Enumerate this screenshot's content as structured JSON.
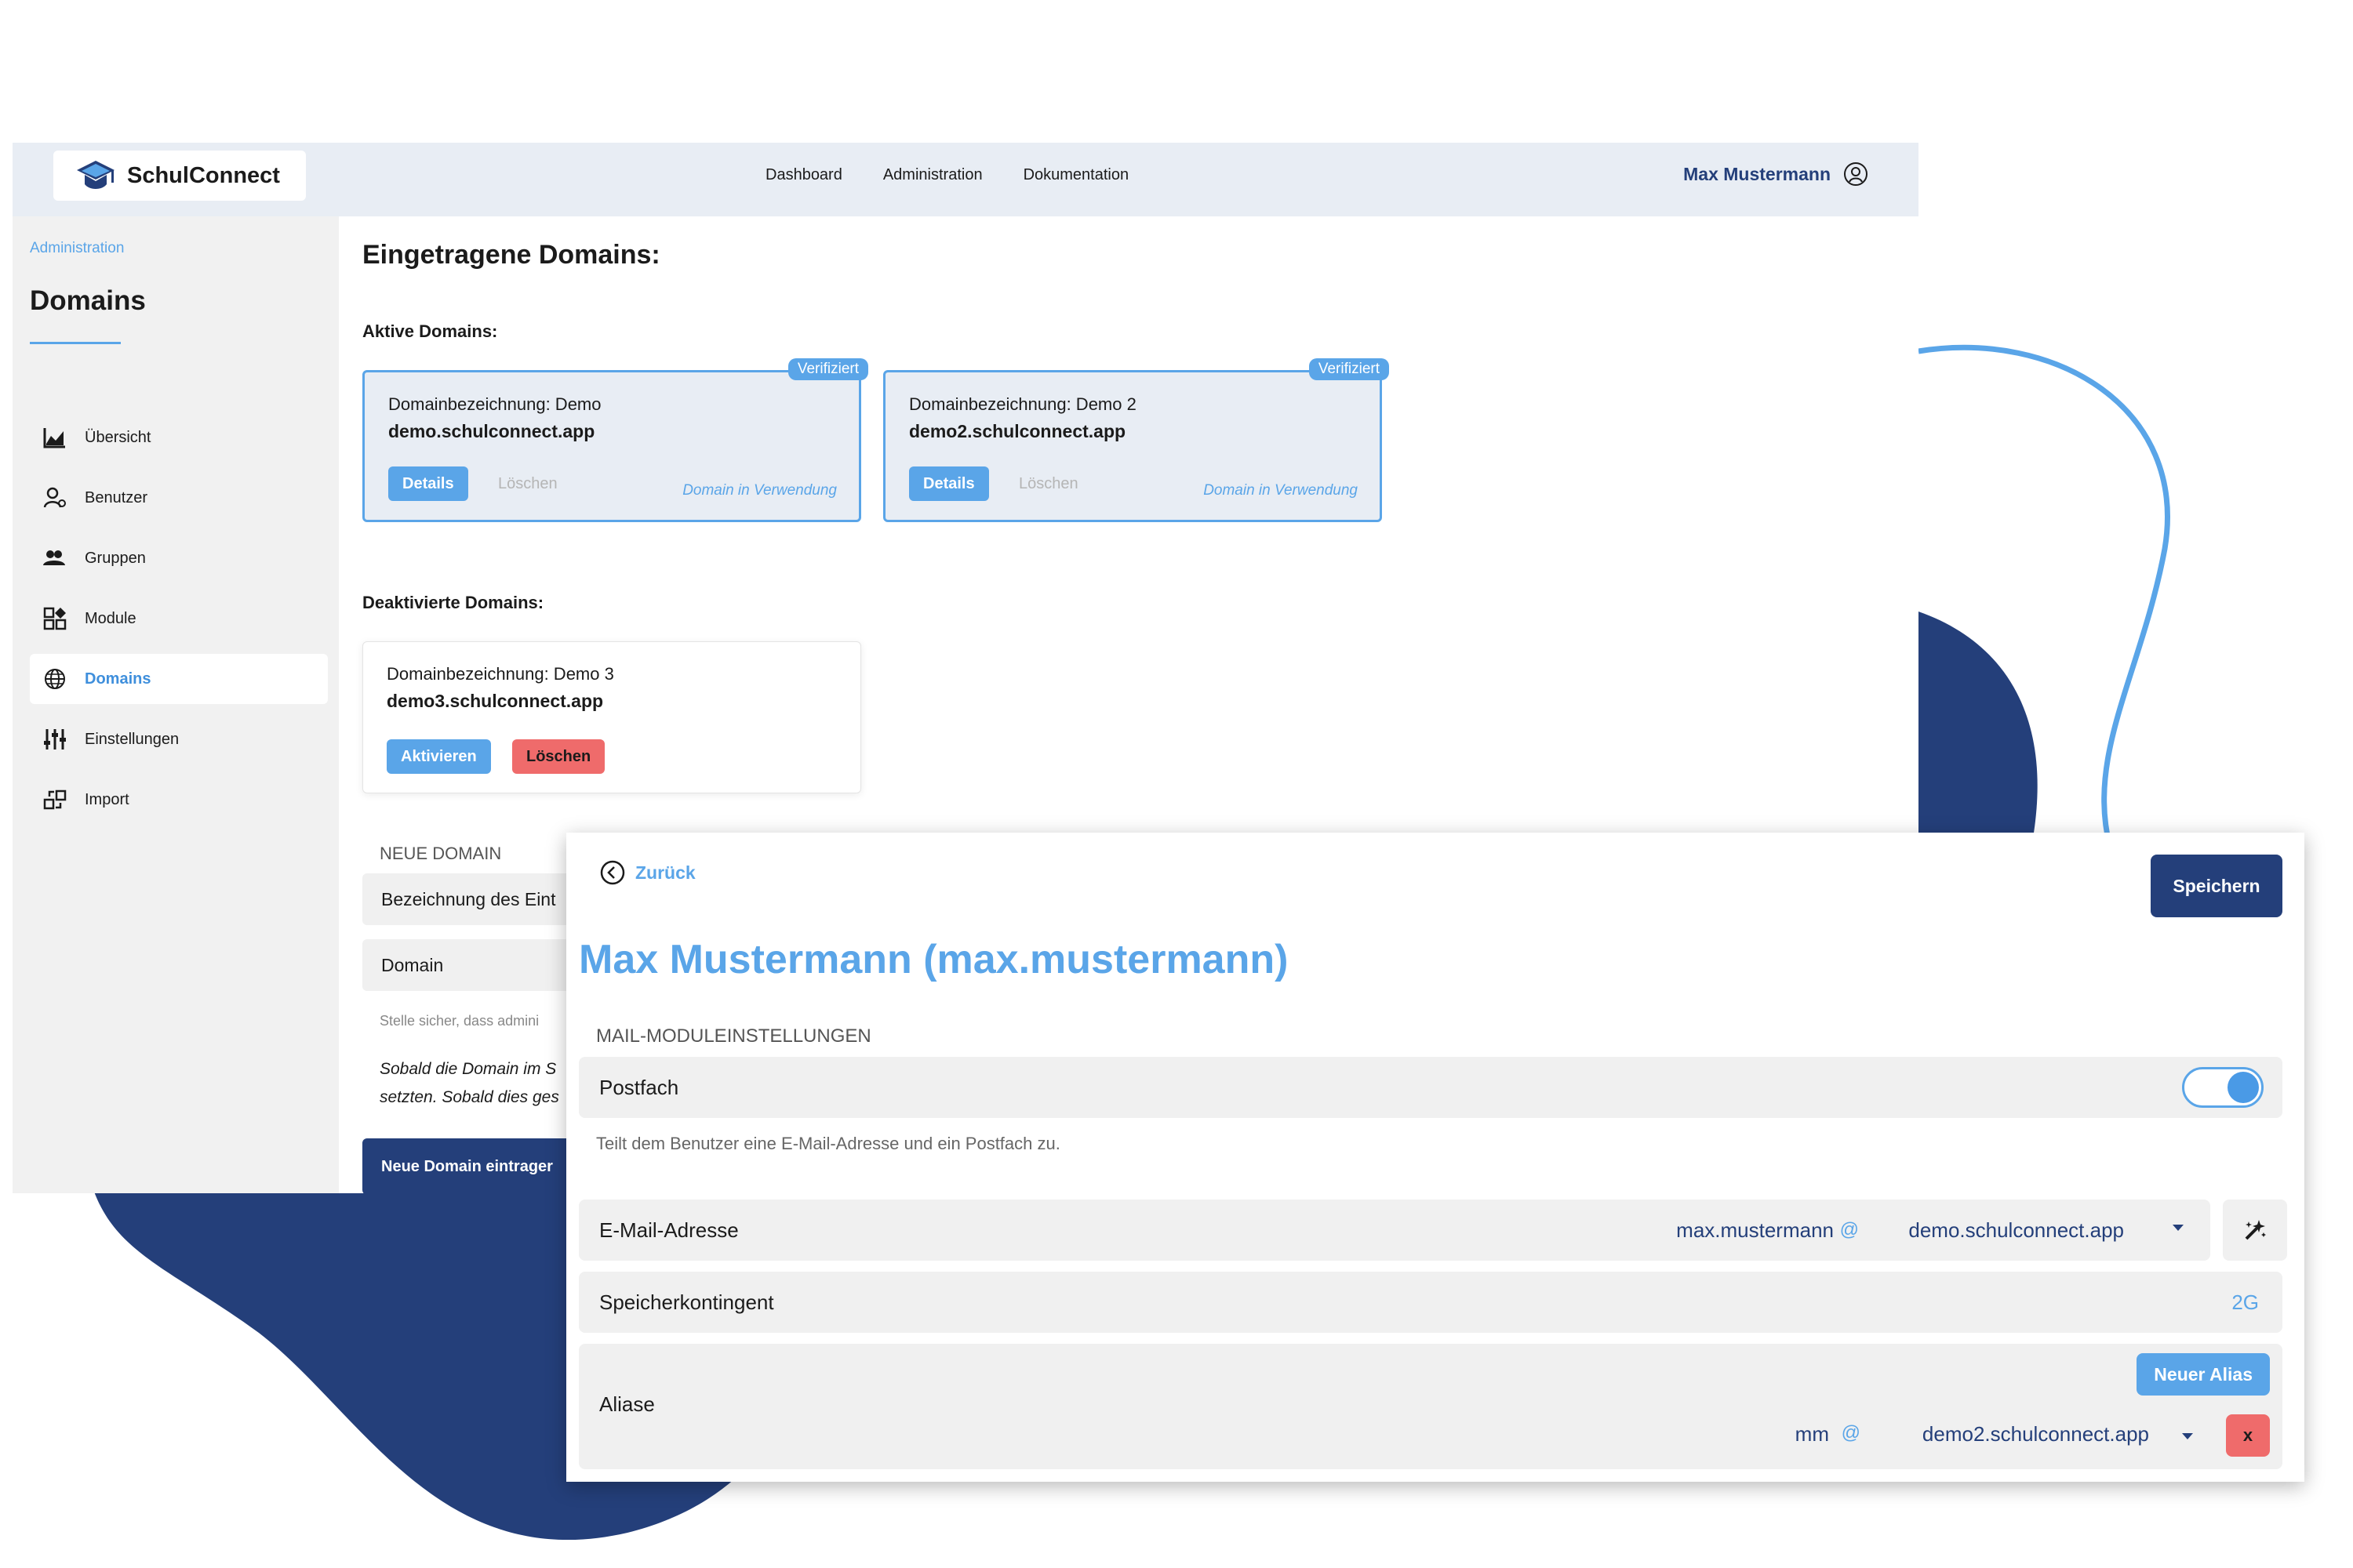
{
  "colors": {
    "accent": "#5aa5e8",
    "navy": "#243f7a",
    "danger": "#ef6b6b",
    "topbar_bg": "#e8edf4",
    "sidebar_bg": "#f1f1f1"
  },
  "header": {
    "logo_text": "SchulConnect",
    "logo_icon": "graduation-cap-icon",
    "nav": [
      "Dashboard",
      "Administration",
      "Dokumentation"
    ],
    "user_name": "Max Mustermann",
    "user_icon": "user-avatar-icon"
  },
  "sidebar": {
    "breadcrumb": "Administration",
    "title": "Domains",
    "items": [
      {
        "label": "Übersicht",
        "icon": "chart-icon"
      },
      {
        "label": "Benutzer",
        "icon": "user-icon"
      },
      {
        "label": "Gruppen",
        "icon": "group-icon"
      },
      {
        "label": "Module",
        "icon": "modules-icon"
      },
      {
        "label": "Domains",
        "icon": "globe-icon"
      },
      {
        "label": "Einstellungen",
        "icon": "sliders-icon"
      },
      {
        "label": "Import",
        "icon": "import-icon"
      }
    ],
    "active_item": "Domains"
  },
  "main": {
    "heading": "Eingetragene Domains:",
    "active_title": "Aktive Domains:",
    "active_domains": [
      {
        "label": "Domainbezeichnung: Demo",
        "domain": "demo.schulconnect.app",
        "badge": "Verifiziert",
        "details": "Details",
        "delete": "Löschen",
        "status": "Domain in Verwendung"
      },
      {
        "label": "Domainbezeichnung: Demo 2",
        "domain": "demo2.schulconnect.app",
        "badge": "Verifiziert",
        "details": "Details",
        "delete": "Löschen",
        "status": "Domain in Verwendung"
      }
    ],
    "inactive_title": "Deaktivierte Domains:",
    "inactive_domains": [
      {
        "label": "Domainbezeichnung: Demo 3",
        "domain": "demo3.schulconnect.app",
        "activate": "Aktivieren",
        "delete": "Löschen"
      }
    ],
    "new_domain": {
      "heading": "NEUE DOMAIN",
      "field_name": "Bezeichnung des Eint",
      "field_domain": "Domain",
      "hint": "Stelle sicher, dass admini",
      "note_line1": "Sobald die Domain im S",
      "note_line2": "setzten. Sobald dies ges",
      "submit": "Neue Domain eintrager"
    }
  },
  "panel": {
    "back": "Zurück",
    "save": "Speichern",
    "title": "Max Mustermann (max.mustermann)",
    "section": "MAIL-MODULEINSTELLUNGEN",
    "postfach_label": "Postfach",
    "postfach_enabled": true,
    "postfach_hint": "Teilt dem Benutzer eine E-Mail-Adresse und ein Postfach zu.",
    "email_label": "E-Mail-Adresse",
    "email_user": "max.mustermann",
    "at": "@",
    "email_domain": "demo.schulconnect.app",
    "generate_icon": "magic-wand-icon",
    "quota_label": "Speicherkontingent",
    "quota_value": "2G",
    "aliase_label": "Aliase",
    "new_alias": "Neuer Alias",
    "alias_user": "mm",
    "alias_domain": "demo2.schulconnect.app",
    "alias_delete": "x"
  }
}
